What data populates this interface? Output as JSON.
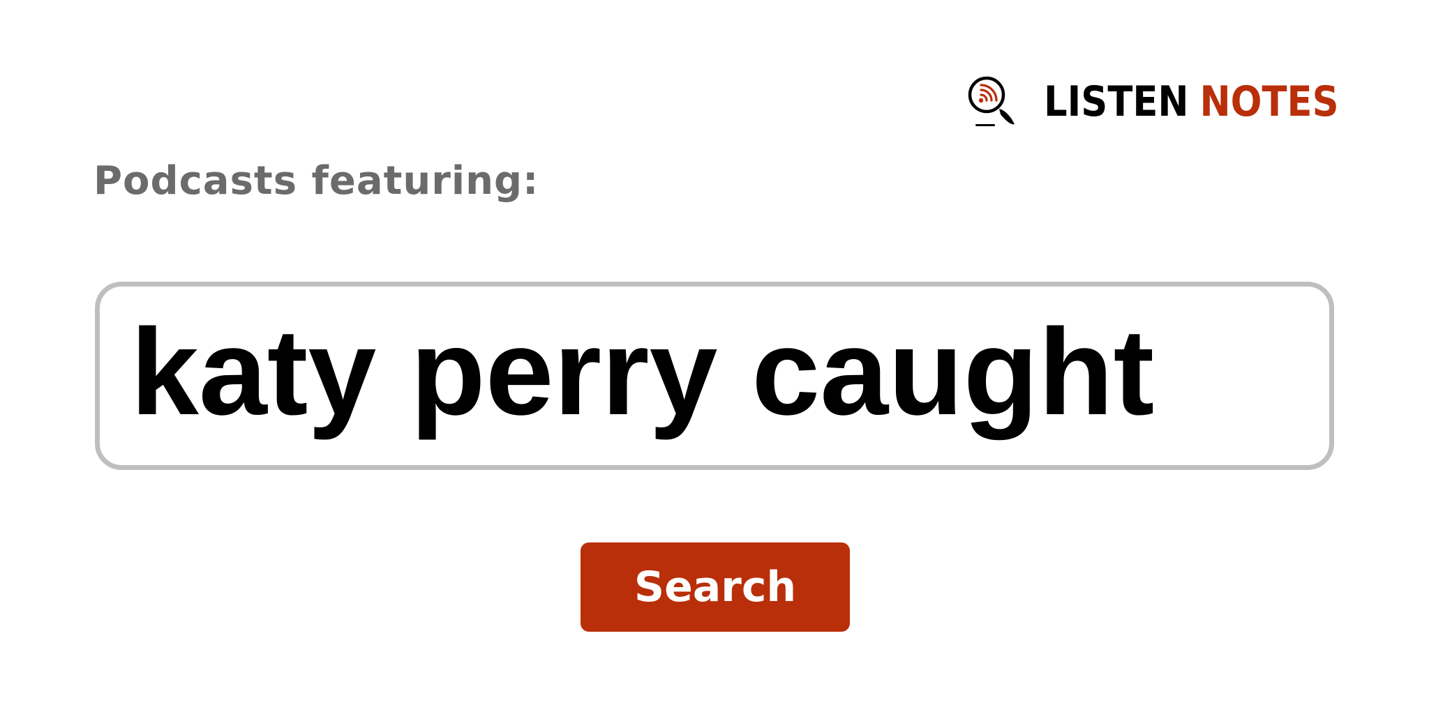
{
  "logo": {
    "text_primary": "LISTEN",
    "text_accent": "NOTES",
    "icon": "podcast-magnifier-icon",
    "primary_color": "#000000",
    "accent_color": "#b92f0a"
  },
  "subtitle": "Podcasts featuring:",
  "query": {
    "value": "katy perry caught"
  },
  "search_button": {
    "label": "Search",
    "color": "#b92f0a"
  }
}
